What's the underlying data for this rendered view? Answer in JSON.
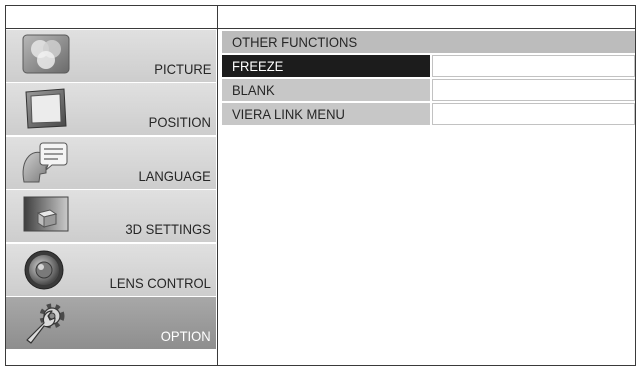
{
  "colors": {
    "frame": "#3a3a3a",
    "item_top": "#e0e0e0",
    "item_bottom": "#cdcdcd",
    "selected_top": "#a8a8a8",
    "selected_bottom": "#8e8e8e",
    "header_bg": "#bcbcbc",
    "row_bg": "#c7c7c7",
    "cursor_bg": "#1c1c1c",
    "value_border": "#c2c2c2",
    "text_dark": "#262626",
    "text_light": "#ffffff"
  },
  "main_menu": {
    "items": [
      {
        "label": "PICTURE",
        "icon": "picture-icon",
        "selected": false
      },
      {
        "label": "POSITION",
        "icon": "position-icon",
        "selected": false
      },
      {
        "label": "LANGUAGE",
        "icon": "language-icon",
        "selected": false
      },
      {
        "label": "3D SETTINGS",
        "icon": "3d-settings-icon",
        "selected": false
      },
      {
        "label": "LENS CONTROL",
        "icon": "lens-control-icon",
        "selected": false
      },
      {
        "label": "OPTION",
        "icon": "option-icon",
        "selected": true
      }
    ]
  },
  "submenu": {
    "title": "OTHER FUNCTIONS",
    "items": [
      {
        "label": "FREEZE",
        "highlighted": true
      },
      {
        "label": "BLANK",
        "highlighted": false
      },
      {
        "label": "VIERA LINK MENU",
        "highlighted": false
      }
    ]
  }
}
